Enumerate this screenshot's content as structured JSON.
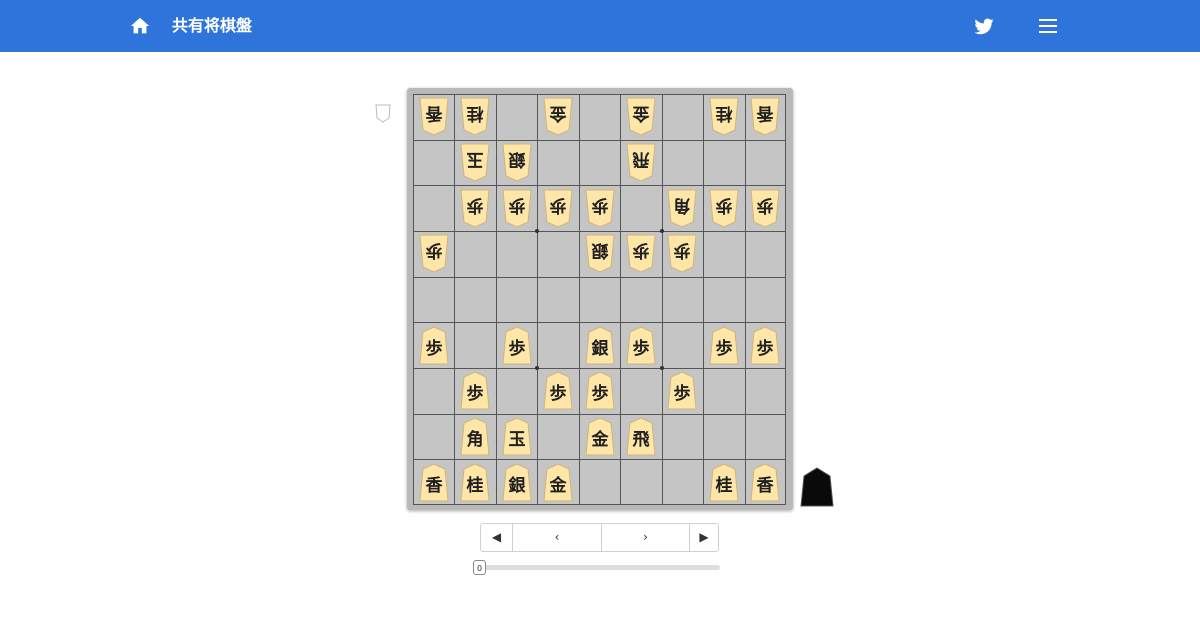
{
  "header": {
    "title": "共有将棋盤",
    "icons": [
      "home-icon",
      "twitter-icon",
      "menu-icon"
    ]
  },
  "colors": {
    "header_bg": "#2e74da",
    "board_bg": "#c5c5c5",
    "piece_fill": "#fde6a8",
    "piece_text": "#1f1f1f"
  },
  "board": {
    "files": 9,
    "ranks": 9,
    "pieces": [
      {
        "file": 9,
        "rank": 1,
        "kanji": "香",
        "owner": "gote"
      },
      {
        "file": 8,
        "rank": 1,
        "kanji": "桂",
        "owner": "gote"
      },
      {
        "file": 6,
        "rank": 1,
        "kanji": "金",
        "owner": "gote"
      },
      {
        "file": 4,
        "rank": 1,
        "kanji": "金",
        "owner": "gote"
      },
      {
        "file": 2,
        "rank": 1,
        "kanji": "桂",
        "owner": "gote"
      },
      {
        "file": 1,
        "rank": 1,
        "kanji": "香",
        "owner": "gote"
      },
      {
        "file": 8,
        "rank": 2,
        "kanji": "玉",
        "owner": "gote"
      },
      {
        "file": 7,
        "rank": 2,
        "kanji": "銀",
        "owner": "gote"
      },
      {
        "file": 4,
        "rank": 2,
        "kanji": "飛",
        "owner": "gote"
      },
      {
        "file": 8,
        "rank": 3,
        "kanji": "歩",
        "owner": "gote"
      },
      {
        "file": 7,
        "rank": 3,
        "kanji": "歩",
        "owner": "gote"
      },
      {
        "file": 6,
        "rank": 3,
        "kanji": "歩",
        "owner": "gote"
      },
      {
        "file": 5,
        "rank": 3,
        "kanji": "歩",
        "owner": "gote"
      },
      {
        "file": 3,
        "rank": 3,
        "kanji": "角",
        "owner": "gote"
      },
      {
        "file": 2,
        "rank": 3,
        "kanji": "歩",
        "owner": "gote"
      },
      {
        "file": 1,
        "rank": 3,
        "kanji": "歩",
        "owner": "gote"
      },
      {
        "file": 9,
        "rank": 4,
        "kanji": "歩",
        "owner": "gote"
      },
      {
        "file": 5,
        "rank": 4,
        "kanji": "銀",
        "owner": "gote"
      },
      {
        "file": 4,
        "rank": 4,
        "kanji": "歩",
        "owner": "gote"
      },
      {
        "file": 3,
        "rank": 4,
        "kanji": "歩",
        "owner": "gote"
      },
      {
        "file": 9,
        "rank": 6,
        "kanji": "歩",
        "owner": "sente"
      },
      {
        "file": 7,
        "rank": 6,
        "kanji": "歩",
        "owner": "sente"
      },
      {
        "file": 5,
        "rank": 6,
        "kanji": "銀",
        "owner": "sente"
      },
      {
        "file": 4,
        "rank": 6,
        "kanji": "歩",
        "owner": "sente"
      },
      {
        "file": 2,
        "rank": 6,
        "kanji": "歩",
        "owner": "sente"
      },
      {
        "file": 1,
        "rank": 6,
        "kanji": "歩",
        "owner": "sente"
      },
      {
        "file": 8,
        "rank": 7,
        "kanji": "歩",
        "owner": "sente"
      },
      {
        "file": 6,
        "rank": 7,
        "kanji": "歩",
        "owner": "sente"
      },
      {
        "file": 5,
        "rank": 7,
        "kanji": "歩",
        "owner": "sente"
      },
      {
        "file": 3,
        "rank": 7,
        "kanji": "歩",
        "owner": "sente"
      },
      {
        "file": 8,
        "rank": 8,
        "kanji": "角",
        "owner": "sente"
      },
      {
        "file": 7,
        "rank": 8,
        "kanji": "玉",
        "owner": "sente"
      },
      {
        "file": 5,
        "rank": 8,
        "kanji": "金",
        "owner": "sente"
      },
      {
        "file": 4,
        "rank": 8,
        "kanji": "飛",
        "owner": "sente"
      },
      {
        "file": 9,
        "rank": 9,
        "kanji": "香",
        "owner": "sente"
      },
      {
        "file": 8,
        "rank": 9,
        "kanji": "桂",
        "owner": "sente"
      },
      {
        "file": 7,
        "rank": 9,
        "kanji": "銀",
        "owner": "sente"
      },
      {
        "file": 6,
        "rank": 9,
        "kanji": "金",
        "owner": "sente"
      },
      {
        "file": 2,
        "rank": 9,
        "kanji": "桂",
        "owner": "sente"
      },
      {
        "file": 1,
        "rank": 9,
        "kanji": "香",
        "owner": "sente"
      }
    ]
  },
  "hands": {
    "gote": {
      "marker": "white-piece-icon"
    },
    "sente": {
      "marker": "black-piece-icon"
    }
  },
  "controls": {
    "first_label": "◀",
    "prev_label": "‹",
    "next_label": "›",
    "last_label": "▶",
    "move_number": "0"
  }
}
